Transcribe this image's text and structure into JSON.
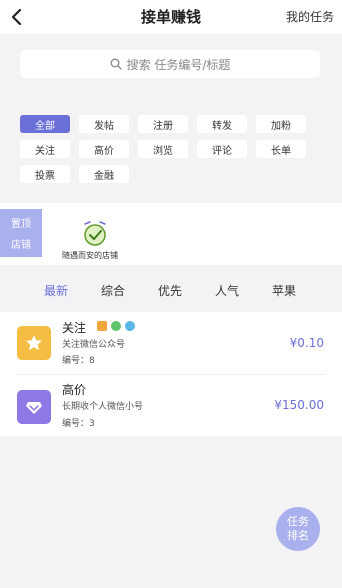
{
  "header": {
    "title": "接单赚钱",
    "right_link": "我的任务"
  },
  "search": {
    "placeholder": "搜索 任务编号/标题"
  },
  "categories": [
    "全部",
    "发帖",
    "注册",
    "转发",
    "加粉",
    "关注",
    "高价",
    "浏览",
    "评论",
    "长单",
    "投票",
    "金融"
  ],
  "active_category": "全部",
  "pin_badge": {
    "line1": "置顶",
    "line2": "店铺"
  },
  "shop": {
    "name": "随遇而安的店铺"
  },
  "sort_tabs": [
    "最新",
    "综合",
    "优先",
    "人气",
    "苹果"
  ],
  "active_sort": "最新",
  "tasks": [
    {
      "title": "关注",
      "subtitle": "关注微信公众号",
      "id_label": "编号：8",
      "price": "¥0.10",
      "icon": "star-icon",
      "icon_color": "#f5bd41"
    },
    {
      "title": "高价",
      "subtitle": "长期收个人微信小号",
      "id_label": "编号：3",
      "price": "¥150.00",
      "icon": "diamond-icon",
      "icon_color": "#8e78e6"
    }
  ],
  "fab": {
    "line1": "任务",
    "line2": "排名"
  },
  "colors": {
    "accent": "#6a70d8",
    "badge": "#a9b0ee",
    "background": "#f3f3f5"
  }
}
